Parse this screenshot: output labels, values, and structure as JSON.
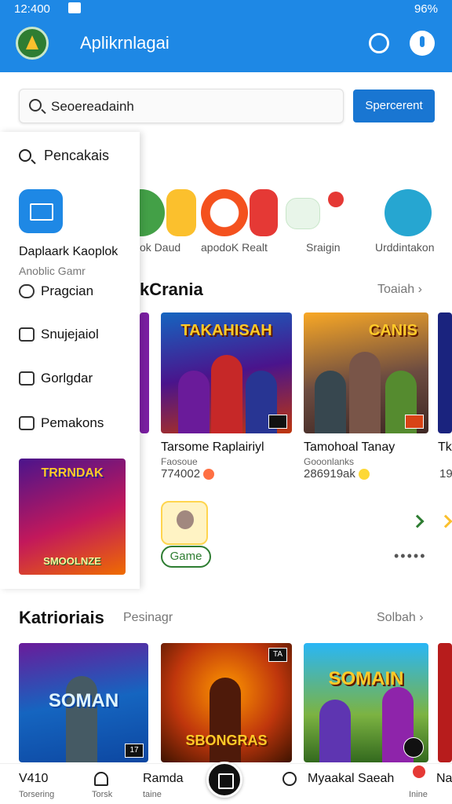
{
  "status_bar": {
    "time": "12:400",
    "battery": "96%"
  },
  "app_bar": {
    "title": "Aplikrnlagai"
  },
  "search": {
    "value": "Seoereadainh",
    "button_label": "Spercerent"
  },
  "drawer": {
    "search_label": "Pencakais",
    "app_heading": "Daplaark Kaoplok",
    "app_sub": "Anoblic Gamr",
    "menu": [
      {
        "label": "Pragcian"
      },
      {
        "label": "Snujejaiol"
      },
      {
        "label": "Gorlgdar"
      },
      {
        "label": "Pemakons"
      }
    ],
    "promo_title": "TRRNDAK",
    "promo_bottom": "SMOOLNZE"
  },
  "app_row": {
    "labels": [
      "ok Daud",
      "apodoK Realt",
      "Sraigin",
      "Urddintakon"
    ]
  },
  "section1": {
    "title": "kCrania",
    "see_all": "Toaiah"
  },
  "games": [
    {
      "art_title": "TAKAHISAH",
      "name": "Tarsome Raplairiyl",
      "sub": "Faosoue",
      "rating": "774002"
    },
    {
      "art_title": "CANIS",
      "name": "Tamohoal Tanay",
      "sub": "Gooonlanks",
      "rating": "286919ak"
    }
  ],
  "partial_right": {
    "name": "Tk",
    "rating": "19"
  },
  "game_pill": "Game",
  "section2": {
    "title": "Katrioriais",
    "subtitle": "Pesinagr",
    "see_all": "Solbah"
  },
  "bottom_cards": [
    {
      "art_title": "SOMAN",
      "corner": "17"
    },
    {
      "art_title": "SBONGRAS",
      "corner": "TA"
    },
    {
      "art_title": "SOMAIN",
      "corner": ""
    }
  ],
  "bottom_nav": [
    {
      "label": "V410",
      "sub": "Torsering"
    },
    {
      "label": "",
      "sub": "Torsk"
    },
    {
      "label": "Ramda",
      "sub": "taine"
    },
    {
      "label": "Myaakal Saeah",
      "sub": ""
    },
    {
      "label": "Na",
      "sub": "Inine"
    }
  ],
  "colors": {
    "primary": "#1e88e5",
    "button": "#1976d2",
    "accent_green": "#2e7d32"
  }
}
